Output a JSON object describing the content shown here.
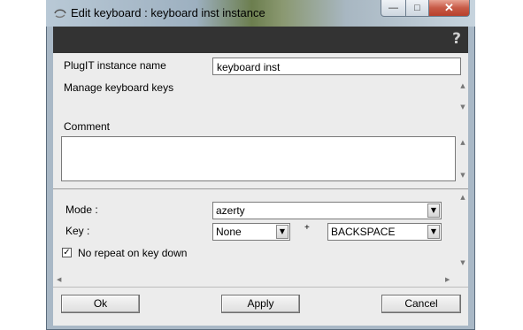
{
  "window": {
    "title": "Edit keyboard : keyboard inst instance",
    "minimize_glyph": "—",
    "maximize_glyph": "□",
    "close_glyph": "✕"
  },
  "header": {
    "help_glyph": "?"
  },
  "form": {
    "instance_name_label": "PlugIT instance name",
    "instance_name_value": "keyboard inst",
    "manage_keys_label": "Manage keyboard keys",
    "comment_label": "Comment",
    "comment_value": ""
  },
  "keys": {
    "mode_label": "Mode :",
    "mode_value": "azerty",
    "key_label": "Key :",
    "modifier_value": "None",
    "plus": "+",
    "key_value": "BACKSPACE",
    "no_repeat_label": "No repeat on key down",
    "no_repeat_checked": true,
    "check_glyph": "✓"
  },
  "buttons": {
    "ok": "Ok",
    "apply": "Apply",
    "cancel": "Cancel"
  }
}
